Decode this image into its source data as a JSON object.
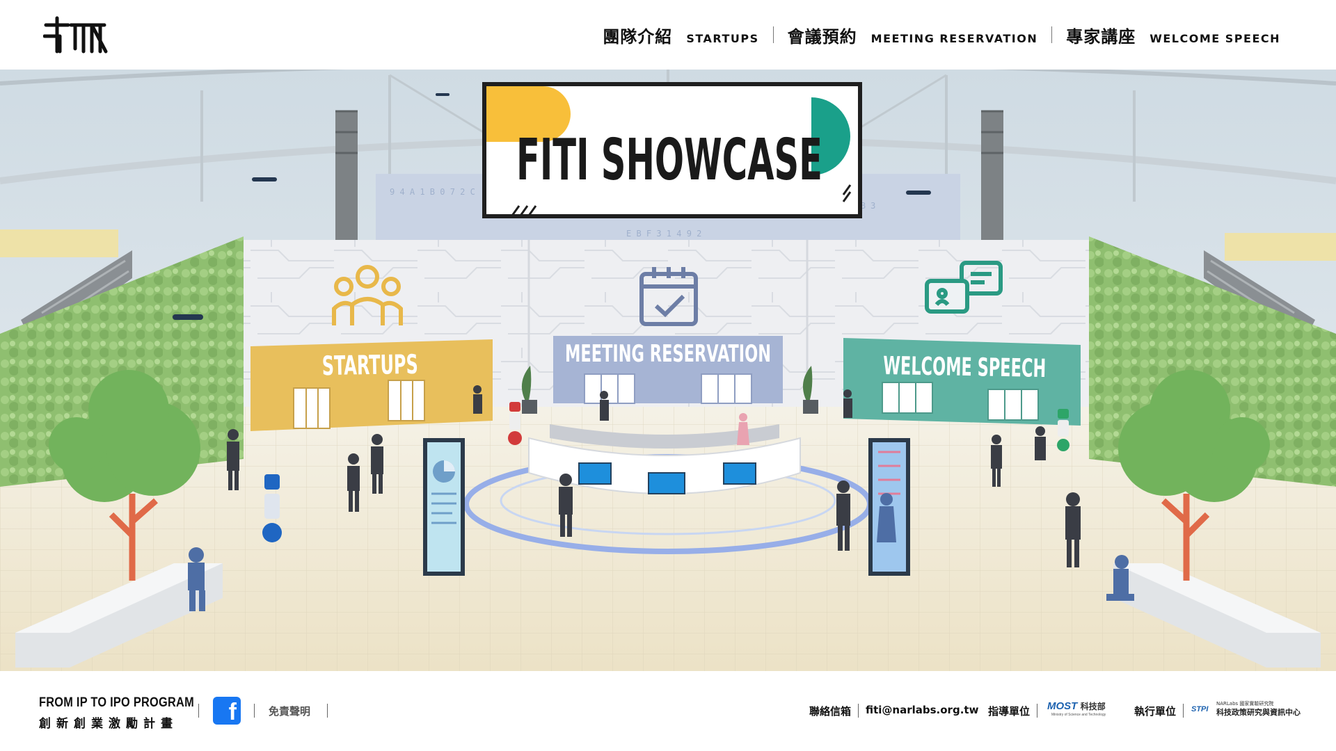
{
  "header": {
    "nav": [
      {
        "zh": "團隊介紹",
        "en": "STARTUPS"
      },
      {
        "zh": "會議預約",
        "en": "MEETING RESERVATION"
      },
      {
        "zh": "專家講座",
        "en": "WELCOME SPEECH"
      }
    ]
  },
  "scene": {
    "banner_title": "FITI SHOWCASE",
    "booths": {
      "startups": "STARTUPS",
      "meeting": "MEETING RESERVATION",
      "speech": "WELCOME SPEECH"
    },
    "colors": {
      "startups": "#e8bf5c",
      "meeting": "#a6b4d4",
      "speech": "#5fb3a3",
      "banner_yellow": "#f8bf3a",
      "banner_teal": "#1aa08a"
    }
  },
  "footer": {
    "program_en": "FROM IP TO IPO PROGRAM",
    "program_zh": "創新創業激勵計畫",
    "facebook_icon": "f",
    "disclaimer": "免責聲明",
    "contact_label": "聯絡信箱",
    "email": "fiti@narlabs.org.tw",
    "guide_label": "指導單位",
    "guide_logo": {
      "mark": "MOST",
      "name": "科技部",
      "sub": "Ministry of Science and Technology"
    },
    "exec_label": "執行單位",
    "exec_logo": {
      "mark": "STPI",
      "top": "NARLabs 國家實驗研究院",
      "name": "科技政策研究與資訊中心"
    }
  }
}
